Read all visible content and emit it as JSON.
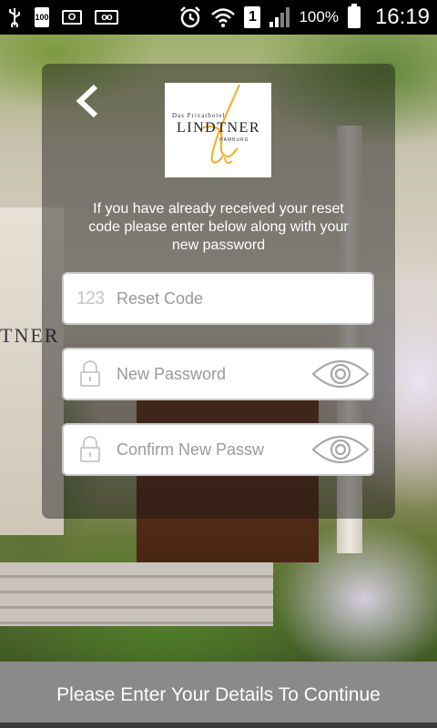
{
  "status_bar": {
    "battery_small_label": "100",
    "outlook_label": "O",
    "voicemail_label": "oo",
    "sim_label": "1",
    "battery_percent": "100%",
    "time": "16:19"
  },
  "background": {
    "sign_text": "TNER"
  },
  "logo": {
    "small_text": "Das Privathotel",
    "name": "LINDTNER",
    "city": "HAMBURG",
    "accent_color": "#f2b233"
  },
  "info": {
    "text": "If you have already received your reset code please enter below along with your new password"
  },
  "form": {
    "reset_code": {
      "icon_text": "123",
      "placeholder": "Reset Code",
      "value": ""
    },
    "new_password": {
      "placeholder": "New Password",
      "value": ""
    },
    "confirm_password": {
      "placeholder": "Confirm New Passw",
      "value": ""
    }
  },
  "footer": {
    "label": "Please Enter Your Details To Continue"
  }
}
